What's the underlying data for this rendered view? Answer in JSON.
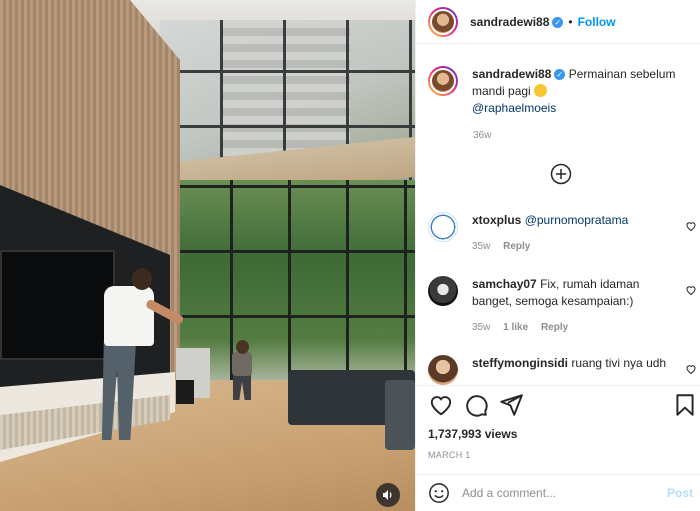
{
  "header": {
    "username": "sandradewi88",
    "separator": "•",
    "follow_label": "Follow"
  },
  "caption": {
    "username": "sandradewi88",
    "text": "Permainan sebelum mandi pagi",
    "mention": "@raphaelmoeis",
    "timestamp": "36w"
  },
  "comments": [
    {
      "username": "xtoxplus",
      "text": "@purnomopratama",
      "timestamp": "35w",
      "likes": "",
      "reply_label": "Reply"
    },
    {
      "username": "samchay07",
      "text": "Fix, rumah idaman banget, semoga kesampaian:)",
      "timestamp": "35w",
      "likes": "1 like",
      "reply_label": "Reply"
    },
    {
      "username": "steffymonginsidi",
      "text": "ruang tivi nya udh",
      "timestamp": "",
      "likes": "",
      "reply_label": ""
    }
  ],
  "stats": {
    "views": "1,737,993 views",
    "date": "MARCH 1"
  },
  "add_comment": {
    "placeholder": "Add a comment...",
    "post_label": "Post"
  },
  "colors": {
    "accent": "#0095f6",
    "link": "#00376b",
    "muted": "#8e8e8e",
    "post_disabled": "#b2dffc"
  },
  "icons": [
    "verified-icon",
    "load-more-plus-icon",
    "heart-icon",
    "comment-icon",
    "share-icon",
    "bookmark-icon",
    "emoji-icon",
    "sound-icon"
  ]
}
